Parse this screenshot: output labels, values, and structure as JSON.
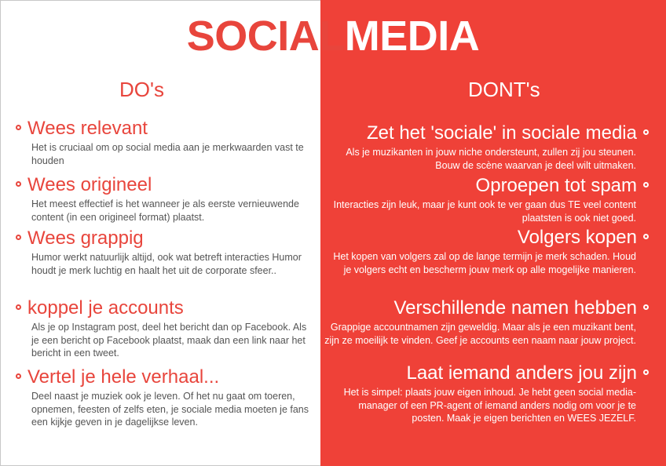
{
  "title": {
    "part1": "SOCIAL",
    "part2": "MEDIA"
  },
  "dos": {
    "heading": "DO's",
    "items": [
      {
        "title": "Wees relevant",
        "text": "Het is cruciaal om op social media aan je merkwaarden vast te houden"
      },
      {
        "title": "Wees origineel",
        "text": "Het meest effectief is het wanneer je als eerste vernieuwende content (in een origineel format) plaatst."
      },
      {
        "title": "Wees grappig",
        "text": "Humor werkt natuurlijk altijd, ook wat betreft interacties Humor houdt je merk luchtig en haalt het uit de corporate sfeer.."
      },
      {
        "title": "koppel je accounts",
        "text": "Als je op Instagram post, deel het bericht dan op Facebook. Als je een bericht op Facebook plaatst, maak dan een link naar het bericht in een tweet."
      },
      {
        "title": "Vertel je hele verhaal...",
        "text": "Deel naast je muziek ook je leven. Of het nu gaat om toeren, opnemen, feesten of zelfs eten, je sociale media moeten je fans een kijkje geven in je dagelijkse leven."
      }
    ]
  },
  "donts": {
    "heading": "DONT's",
    "items": [
      {
        "title": "Zet het 'sociale' in sociale media",
        "text": "Als je muzikanten in jouw niche ondersteunt, zullen zij jou steunen. Bouw de scène waarvan je deel wilt uitmaken."
      },
      {
        "title": "Oproepen tot spam",
        "text": "Interacties zijn leuk, maar je kunt ook te ver gaan dus TE veel content plaatsten is ook niet goed."
      },
      {
        "title": "Volgers kopen",
        "text": "Het kopen van volgers zal op de lange termijn je merk schaden. Houd je volgers echt en bescherm jouw merk op alle mogelijke manieren."
      },
      {
        "title": "Verschillende namen hebben",
        "text": "Grappige accountnamen zijn geweldig. Maar als je een muzikant bent, zijn ze moeilijk te vinden. Geef je accounts een naam naar jouw project."
      },
      {
        "title": "Laat iemand anders jou zijn",
        "text": "Het is simpel: plaats jouw eigen inhoud. Je hebt geen social media-manager of een PR-agent of iemand anders nodig om voor je te posten. Maak je eigen berichten en WEES JEZELF."
      }
    ]
  },
  "colors": {
    "accent": "#ef4138",
    "text_dark": "#555555",
    "background": "#ffffff"
  }
}
